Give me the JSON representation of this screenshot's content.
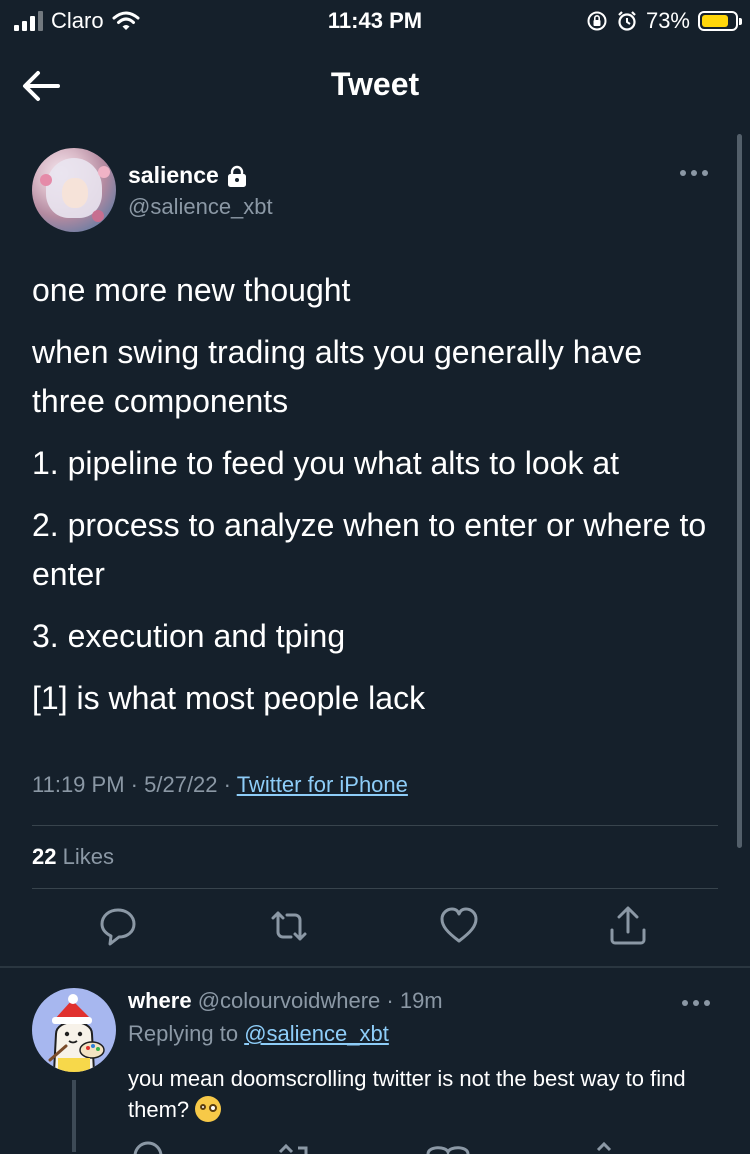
{
  "status_bar": {
    "carrier": "Claro",
    "time": "11:43 PM",
    "battery_percent": "73%",
    "battery_level": 0.73,
    "battery_color": "#ffd60a"
  },
  "nav": {
    "back_icon": "back-arrow-icon",
    "title": "Tweet"
  },
  "tweet": {
    "author": {
      "name": "salience",
      "handle": "@salience_xbt",
      "locked_icon": "lock-icon"
    },
    "paragraphs": [
      "one more new thought",
      "when swing trading alts you generally have three components",
      "1. pipeline to feed you what alts to look at",
      "2. process to analyze when to enter or where to enter",
      "3. execution and tping",
      "[1] is what most people lack"
    ],
    "time": "11:19 PM",
    "date": "5/27/22",
    "separator": "·",
    "source": "Twitter for iPhone",
    "likes_count": "22",
    "likes_label": "Likes"
  },
  "actions": [
    "reply-icon",
    "retweet-icon",
    "like-icon",
    "share-icon"
  ],
  "reply": {
    "name": "where",
    "handle": "@colourvoidwhere",
    "separator": "·",
    "age": "19m",
    "replying_prefix": "Replying to",
    "replying_to": "@salience_xbt",
    "text": "you mean doomscrolling twitter is not the best way to find them?"
  },
  "colors": {
    "background": "#15202b",
    "secondary_text": "#8b98a5",
    "link": "#8ecdf8",
    "divider": "#38444d"
  }
}
